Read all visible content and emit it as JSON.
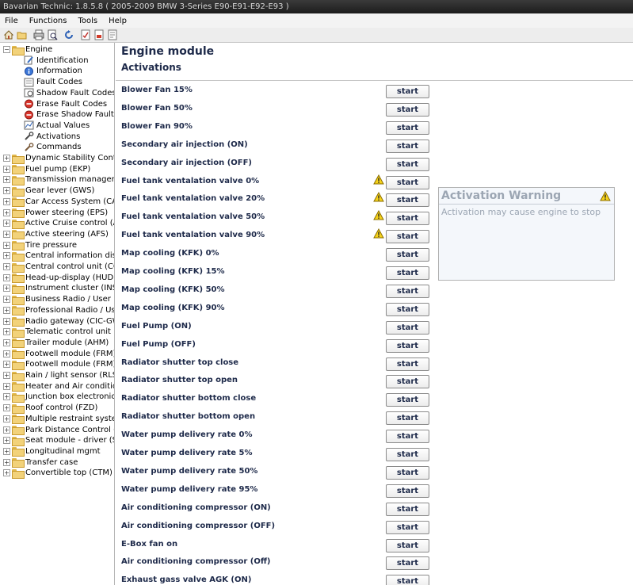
{
  "window": {
    "title": "Bavarian Technic: 1.8.5.8 ( 2005-2009 BMW 3-Series E90-E91-E92-E93 )"
  },
  "menu": {
    "items": [
      "File",
      "Functions",
      "Tools",
      "Help"
    ]
  },
  "toolbar": {
    "icons": [
      "home-icon",
      "open-folder-icon",
      "print-icon",
      "print-preview-icon",
      "refresh-icon",
      "report-icon",
      "pdf-icon",
      "export-icon"
    ]
  },
  "tree": {
    "root": {
      "label": "Engine",
      "expander": "−"
    },
    "engine_children": [
      {
        "label": "Identification",
        "icon": "identification-icon"
      },
      {
        "label": "Information",
        "icon": "info-icon"
      },
      {
        "label": "Fault Codes",
        "icon": "fault-codes-icon"
      },
      {
        "label": "Shadow Fault Codes",
        "icon": "shadow-fault-codes-icon"
      },
      {
        "label": "Erase Fault Codes",
        "icon": "erase-icon"
      },
      {
        "label": "Erase Shadow Fault",
        "icon": "erase-icon"
      },
      {
        "label": "Actual Values",
        "icon": "actual-values-icon"
      },
      {
        "label": "Activations",
        "icon": "activations-icon"
      },
      {
        "label": "Commands",
        "icon": "commands-icon"
      }
    ],
    "modules": [
      "Dynamic Stability Contro",
      "Fuel pump (EKP)",
      "Transmission manageme",
      "Gear lever (GWS)",
      "Car Access System (CA",
      "Power steering (EPS)",
      "Active Cruise control (AC",
      "Active steering (AFS)",
      "Tire pressure",
      "Central information displ",
      "Central control unit (CON",
      "Head-up-display (HUD)",
      "Instrument cluster (INST",
      "Business Radio / User in",
      "Professional Radio / Use",
      "Radio gateway (CIC-GW",
      "Telematic control unit (T",
      "Trailer module (AHM)",
      "Footwell module (FRM) f",
      "Footwell module (FRM) f",
      "Rain / light sensor (RLS",
      "Heater and Air condition",
      "Junction box electronics",
      "Roof control (FZD)",
      "Multiple restraint system",
      "Park Distance Control (P",
      "Seat module - driver (SM",
      "Longitudinal mgmt",
      "Transfer case",
      "Convertible top (CTM)"
    ],
    "expander_collapsed": "+"
  },
  "main": {
    "title": "Engine module",
    "section": "Activations",
    "button_label": "start",
    "activations": [
      {
        "label": "Blower Fan 15%",
        "warning": false
      },
      {
        "label": "Blower Fan 50%",
        "warning": false
      },
      {
        "label": "Blower Fan 90%",
        "warning": false
      },
      {
        "label": "Secondary air injection (ON)",
        "warning": false
      },
      {
        "label": "Secondary air injection (OFF)",
        "warning": false
      },
      {
        "label": "Fuel tank ventalation valve 0%",
        "warning": true
      },
      {
        "label": "Fuel tank ventalation valve 20%",
        "warning": true
      },
      {
        "label": "Fuel tank ventalation valve 50%",
        "warning": true
      },
      {
        "label": "Fuel tank ventalation valve 90%",
        "warning": true
      },
      {
        "label": "Map cooling (KFK) 0%",
        "warning": false
      },
      {
        "label": "Map cooling (KFK) 15%",
        "warning": false
      },
      {
        "label": "Map cooling (KFK) 50%",
        "warning": false
      },
      {
        "label": "Map cooling (KFK) 90%",
        "warning": false
      },
      {
        "label": "Fuel Pump (ON)",
        "warning": false
      },
      {
        "label": "Fuel Pump (OFF)",
        "warning": false
      },
      {
        "label": "Radiator shutter top close",
        "warning": false
      },
      {
        "label": "Radiator shutter top open",
        "warning": false
      },
      {
        "label": "Radiator shutter bottom close",
        "warning": false
      },
      {
        "label": "Radiator shutter bottom open",
        "warning": false
      },
      {
        "label": "Water pump delivery rate 0%",
        "warning": false
      },
      {
        "label": "Water pump delivery rate 5%",
        "warning": false
      },
      {
        "label": "Water pump delivery rate 50%",
        "warning": false
      },
      {
        "label": "Water pump delivery rate 95%",
        "warning": false
      },
      {
        "label": "Air conditioning compressor (ON)",
        "warning": false
      },
      {
        "label": "Air conditioning compressor (OFF)",
        "warning": false
      },
      {
        "label": "E-Box fan on",
        "warning": false
      },
      {
        "label": "Air conditioning compressor (Off)",
        "warning": false
      },
      {
        "label": "Exhaust gass valve AGK (ON)",
        "warning": false
      }
    ]
  },
  "warning_panel": {
    "title": "Activation Warning",
    "message": "Activation may cause engine to stop",
    "icon": "warning-triangle-icon"
  },
  "colors": {
    "label_text": "#1e2a4a",
    "warning_text": "#9ca6b3",
    "warning_yellow": "#f5d21a",
    "folder_yellow": "#f2d27a"
  }
}
